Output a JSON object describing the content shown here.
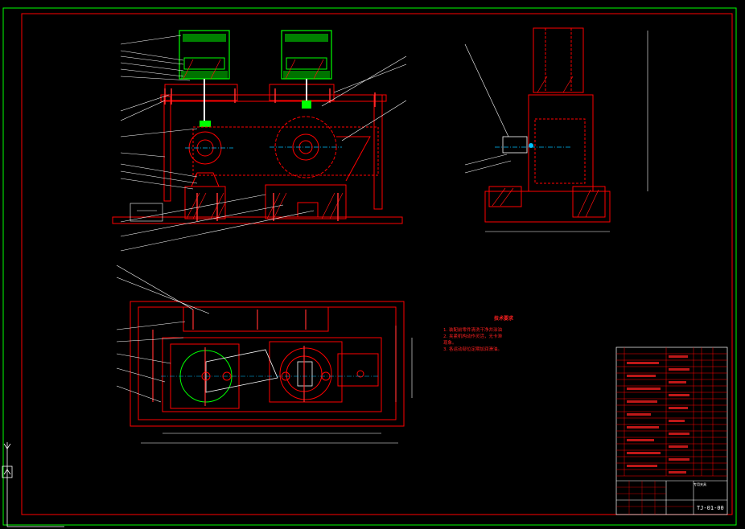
{
  "drawing": {
    "tech_req_title": "技术要求",
    "tech_req_items": [
      "1. 装配前零件清洗干净并涂油",
      "2. 夹紧机构动作灵活，无卡滞",
      "   现象。",
      "3. 各运动部位定期加润滑油。"
    ],
    "drawing_code": "TJ-01-00",
    "title_block_name": "专用夹具"
  },
  "colors": {
    "background": "#000000",
    "outer_frame": "#00ff00",
    "inner_frame": "#ff0000",
    "part_lines": "#ff0000",
    "hatch": "#ff1010",
    "fixture_green": "#00ff00",
    "leader_lines": "#ffffff",
    "accent_blue": "#00c0ff"
  },
  "icons": {
    "ucs": "ucs-axis-icon"
  }
}
